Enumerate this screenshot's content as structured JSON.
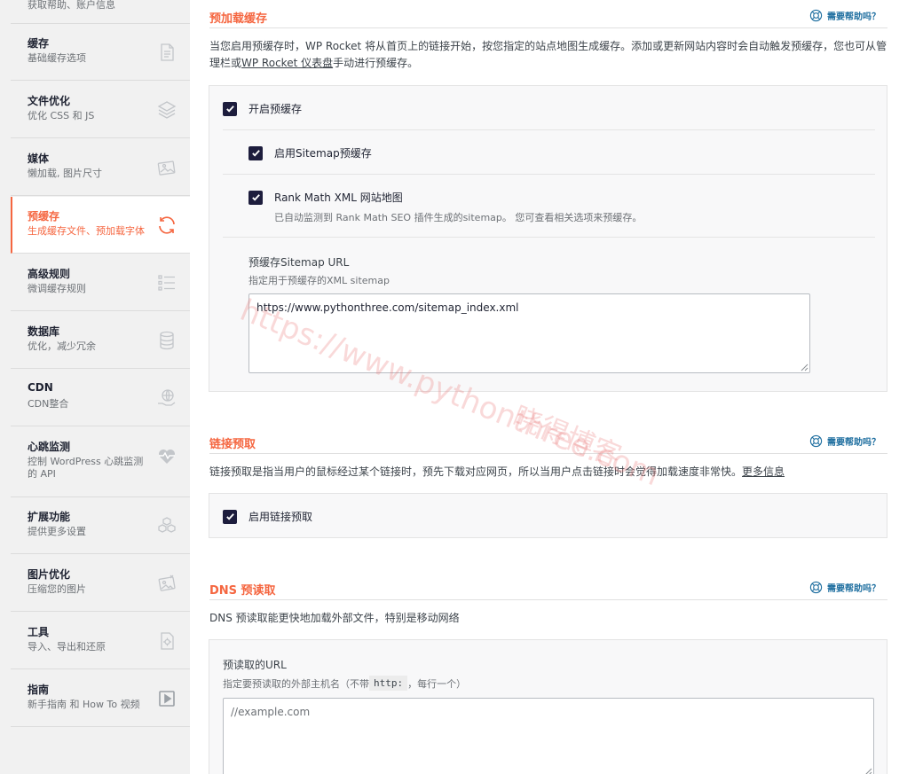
{
  "sidebar": {
    "top_fragment": "获取帮助、账户信息",
    "items": [
      {
        "title": "缓存",
        "desc": "基础缓存选项",
        "icon": "document-icon"
      },
      {
        "title": "文件优化",
        "desc": "优化 CSS 和 JS",
        "icon": "layers-icon"
      },
      {
        "title": "媒体",
        "desc": "懒加载, 图片尺寸",
        "icon": "image-icon"
      },
      {
        "title": "预缓存",
        "desc": "生成缓存文件、预加载字体",
        "icon": "refresh-icon",
        "active": true
      },
      {
        "title": "高级规则",
        "desc": "微调缓存规则",
        "icon": "list-icon"
      },
      {
        "title": "数据库",
        "desc": "优化，减少冗余",
        "icon": "database-icon"
      },
      {
        "title": "CDN",
        "desc": "CDN整合",
        "icon": "globe-hand-icon"
      },
      {
        "title": "心跳监测",
        "desc": "控制 WordPress 心跳监测的 API",
        "icon": "heartbeat-icon"
      },
      {
        "title": "扩展功能",
        "desc": "提供更多设置",
        "icon": "cubes-icon"
      },
      {
        "title": "图片优化",
        "desc": "压缩您的图片",
        "icon": "photo-compress-icon"
      },
      {
        "title": "工具",
        "desc": "导入、导出和还原",
        "icon": "gear-doc-icon"
      },
      {
        "title": "指南",
        "desc": "新手指南 和 How To 视频",
        "icon": "play-icon"
      }
    ]
  },
  "help_label": "需要帮助吗？",
  "preload": {
    "title": "预加载缓存",
    "desc_before": "当您启用预缓存时，WP Rocket 将从首页上的链接开始，按您指定的站点地图生成缓存。添加或更新网站内容时会自动触发预缓存，您也可从管理栏或",
    "desc_link": "WP Rocket 仪表盘",
    "desc_after": "手动进行预缓存。",
    "enable_label": "开启预缓存",
    "sitemap_label": "启用Sitemap预缓存",
    "rankmath_label": "Rank Math XML 网站地图",
    "rankmath_desc": "已自动监测到 Rank Math SEO 插件生成的sitemap。 您可查看相关选项来预缓存。",
    "url_label": "预缓存Sitemap URL",
    "url_desc": "指定用于预缓存的XML sitemap",
    "url_value": "https://www.pythonthree.com/sitemap_index.xml"
  },
  "prefetch": {
    "title": "链接预取",
    "desc": "链接预取是指当用户的鼠标经过某个链接时，预先下载对应网页，所以当用户点击链接时会觉得加载速度非常快。",
    "more": "更多信息",
    "enable_label": "启用链接预取"
  },
  "dns": {
    "title": "DNS 预读取",
    "desc": "DNS 预读取能更快地加载外部文件，特别是移动网络",
    "url_label": "预读取的URL",
    "url_desc_before": "指定要预读取的外部主机名（不带",
    "url_desc_code": "http:",
    "url_desc_after": "，每行一个）",
    "placeholder": "//example.com"
  },
  "watermark": {
    "url": "https://www.pythonthree.com",
    "name": "晓得博客"
  },
  "colors": {
    "accent": "#f56640",
    "checkbox": "#1d1d3d",
    "help": "#1f6fa0"
  }
}
